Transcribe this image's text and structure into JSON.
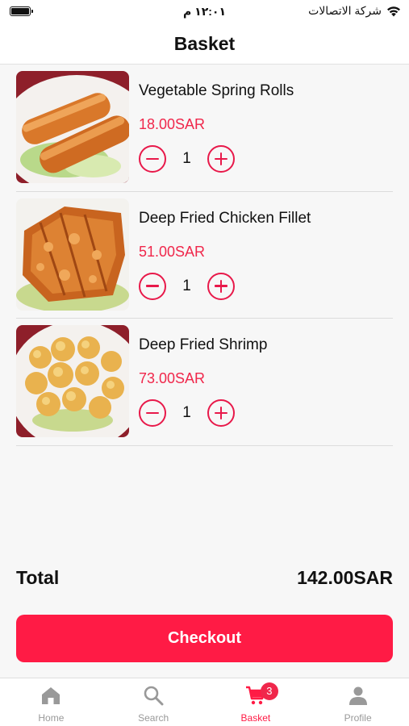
{
  "status_bar": {
    "time": "١٢:٠١ م",
    "carrier": "شركة الاتصالات"
  },
  "header": {
    "title": "Basket"
  },
  "basket": {
    "items": [
      {
        "name": "Vegetable Spring Rolls",
        "price": "18.00SAR",
        "quantity": "1"
      },
      {
        "name": "Deep Fried Chicken Fillet",
        "price": "51.00SAR",
        "quantity": "1"
      },
      {
        "name": "Deep Fried Shrimp",
        "price": "73.00SAR",
        "quantity": "1"
      }
    ]
  },
  "summary": {
    "total_label": "Total",
    "total_value": "142.00SAR"
  },
  "checkout": {
    "label": "Checkout"
  },
  "tab_bar": {
    "tabs": [
      {
        "label": "Home",
        "icon": "home-icon"
      },
      {
        "label": "Search",
        "icon": "search-icon"
      },
      {
        "label": "Basket",
        "icon": "cart-icon",
        "badge": "3",
        "active": true
      },
      {
        "label": "Profile",
        "icon": "person-icon"
      }
    ]
  },
  "colors": {
    "accent": "#ff1b45",
    "price": "#f0274b",
    "stepper": "#e8194a",
    "inactive_tab": "#999999"
  }
}
